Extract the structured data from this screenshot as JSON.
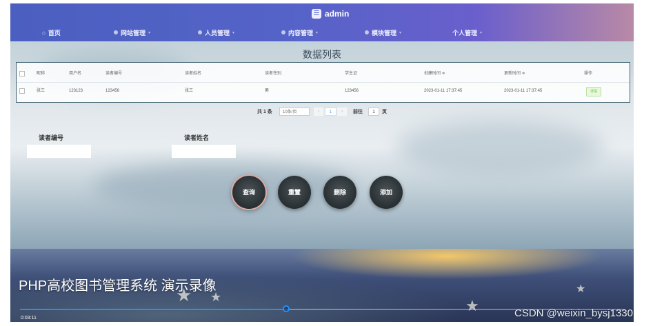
{
  "brand": {
    "icon": "app-logo-icon",
    "title": "admin"
  },
  "nav": [
    {
      "label": "首页",
      "icon": "home-icon"
    },
    {
      "label": "网站管理",
      "icon": "web-icon"
    },
    {
      "label": "人员管理",
      "icon": "user-icon"
    },
    {
      "label": "内容管理",
      "icon": "content-icon"
    },
    {
      "label": "模块管理",
      "icon": "module-icon"
    },
    {
      "label": "个人管理",
      "icon": "person-icon"
    }
  ],
  "list": {
    "title": "数据列表",
    "columns": [
      "昵称",
      "用户名",
      "读者编号",
      "读者姓名",
      "读者性别",
      "学生证",
      "创建时间 ≑",
      "更新时间 ≑",
      "操作"
    ],
    "rows": [
      {
        "cells": [
          "张三",
          "123123",
          "123456",
          "张三",
          "男",
          "123456",
          "2023-01-11 17:37:45",
          "2023-01-11 17:37:45"
        ],
        "action": "详情"
      }
    ]
  },
  "pager": {
    "total": "共 1 条",
    "page_size": "10条/页",
    "prev": "‹",
    "current": "1",
    "next": "›",
    "goto_label": "前往",
    "goto_value": "1",
    "page_suffix": "页"
  },
  "search": {
    "reader_no_label": "读者编号",
    "reader_name_label": "读者姓名"
  },
  "actions": {
    "query": "查询",
    "reset": "重置",
    "delete": "删除",
    "add": "添加"
  },
  "video": {
    "title": "PHP高校图书管理系统 演示录像",
    "time": "0:03:11",
    "progress": 0.44
  },
  "watermark": "CSDN @weixin_bysj1330",
  "colors": {
    "topbar_start": "#4b5fc0",
    "topbar_end": "#b989a6",
    "progress": "#1e90ff",
    "detail": "#67c23a"
  }
}
